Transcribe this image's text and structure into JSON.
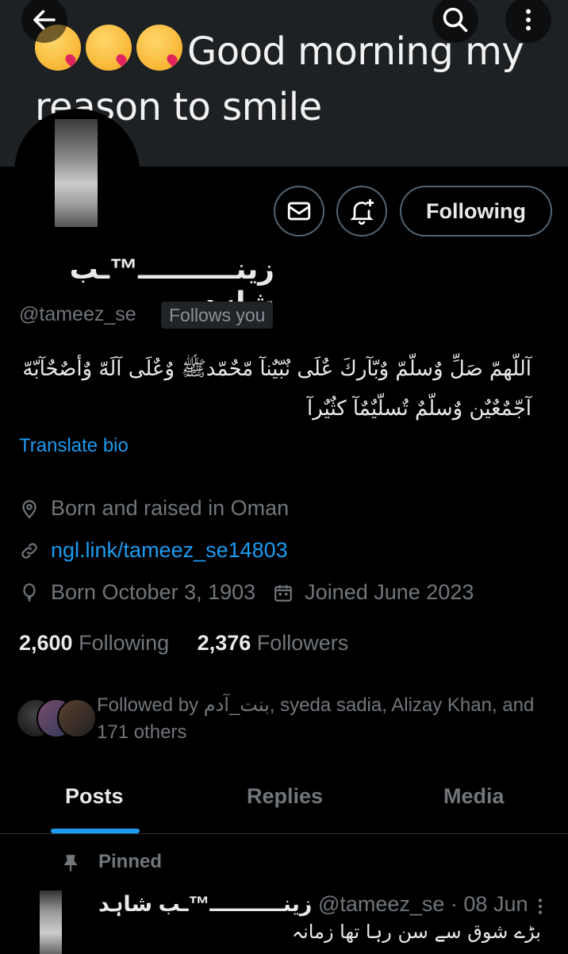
{
  "banner": {
    "text": "Good morning my reason to smile",
    "emoji_icons": [
      "kissing-heart-emoji",
      "kissing-heart-emoji",
      "kissing-heart-emoji"
    ]
  },
  "header": {
    "back_icon": "arrow-left-icon",
    "search_icon": "search-icon",
    "more_icon": "more-vertical-icon"
  },
  "actions": {
    "message_icon": "envelope-icon",
    "notify_icon": "bell-plus-icon",
    "follow_label": "Following"
  },
  "profile": {
    "name": "زینــــــــــ™ـب شاہد",
    "handle": "@tameez_se",
    "follows_you": "Follows you",
    "bio_line1": "آللّهمّ صَلِّ وٌسلّمّ وٌبّآركَ  عٌلَى نٌبّيٌنآ مّحٌمّدﷺ وٌعٌلَى آلَهّ وٌأصٌحٌآبّهّ",
    "bio_line2": "آجّمٌعٌيٌن وٌسلّمٌ تٌسلّيٌمٌآ كثٌيٌرآ",
    "translate": "Translate bio",
    "location": "Born and raised in Oman",
    "link": "ngl.link/tameez_se14803",
    "birthday": "Born October 3, 1903",
    "joined": "Joined June 2023"
  },
  "stats": {
    "following_count": "2,600",
    "following_label": "Following",
    "followers_count": "2,376",
    "followers_label": "Followers"
  },
  "followed_by": {
    "prefix": "Followed by ",
    "names": "بنت_آدم, syeda sadia, Alizay Khan, and",
    "others": "171 others"
  },
  "tabs": [
    {
      "label": "Posts",
      "active": true
    },
    {
      "label": "Replies",
      "active": false
    },
    {
      "label": "Media",
      "active": false
    }
  ],
  "post": {
    "pinned_label": "Pinned",
    "author": "زینــــــــــ™ـب شاہد",
    "meta": "@tameez_se · 08 Jun",
    "text": "بڑے شوق سے سن رہا تھا زمانہ"
  },
  "colors": {
    "accent": "#1d9bf0",
    "muted": "#71767b",
    "background": "#000000",
    "text": "#e7e9ea"
  }
}
